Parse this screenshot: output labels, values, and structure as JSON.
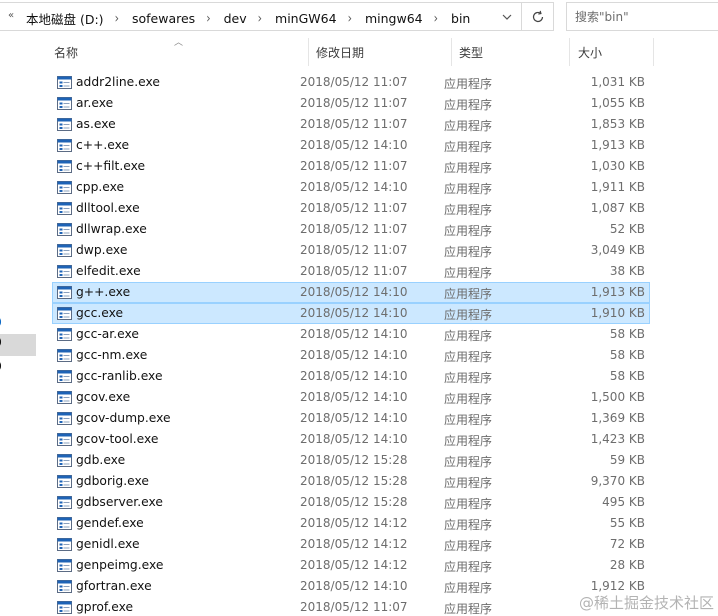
{
  "address_bar": {
    "overflow_glyph": "«",
    "crumbs": [
      "本地磁盘 (D:)",
      "sofewares",
      "dev",
      "minGW64",
      "mingw64",
      "bin"
    ]
  },
  "search": {
    "placeholder": "搜索\"bin\""
  },
  "columns": {
    "name": "名称",
    "date": "修改日期",
    "type": "类型",
    "size": "大小"
  },
  "sort": {
    "column": "name",
    "direction": "ascending"
  },
  "files": [
    {
      "name": "addr2line.exe",
      "modified": "2018/05/12 11:07",
      "type": "应用程序",
      "size": "1,031 KB",
      "selected": false
    },
    {
      "name": "ar.exe",
      "modified": "2018/05/12 11:07",
      "type": "应用程序",
      "size": "1,055 KB",
      "selected": false
    },
    {
      "name": "as.exe",
      "modified": "2018/05/12 11:07",
      "type": "应用程序",
      "size": "1,853 KB",
      "selected": false
    },
    {
      "name": "c++.exe",
      "modified": "2018/05/12 14:10",
      "type": "应用程序",
      "size": "1,913 KB",
      "selected": false
    },
    {
      "name": "c++filt.exe",
      "modified": "2018/05/12 11:07",
      "type": "应用程序",
      "size": "1,030 KB",
      "selected": false
    },
    {
      "name": "cpp.exe",
      "modified": "2018/05/12 14:10",
      "type": "应用程序",
      "size": "1,911 KB",
      "selected": false
    },
    {
      "name": "dlltool.exe",
      "modified": "2018/05/12 11:07",
      "type": "应用程序",
      "size": "1,087 KB",
      "selected": false
    },
    {
      "name": "dllwrap.exe",
      "modified": "2018/05/12 11:07",
      "type": "应用程序",
      "size": "52 KB",
      "selected": false
    },
    {
      "name": "dwp.exe",
      "modified": "2018/05/12 11:07",
      "type": "应用程序",
      "size": "3,049 KB",
      "selected": false
    },
    {
      "name": "elfedit.exe",
      "modified": "2018/05/12 11:07",
      "type": "应用程序",
      "size": "38 KB",
      "selected": false
    },
    {
      "name": "g++.exe",
      "modified": "2018/05/12 14:10",
      "type": "应用程序",
      "size": "1,913 KB",
      "selected": true
    },
    {
      "name": "gcc.exe",
      "modified": "2018/05/12 14:10",
      "type": "应用程序",
      "size": "1,910 KB",
      "selected": true
    },
    {
      "name": "gcc-ar.exe",
      "modified": "2018/05/12 14:10",
      "type": "应用程序",
      "size": "58 KB",
      "selected": false
    },
    {
      "name": "gcc-nm.exe",
      "modified": "2018/05/12 14:10",
      "type": "应用程序",
      "size": "58 KB",
      "selected": false
    },
    {
      "name": "gcc-ranlib.exe",
      "modified": "2018/05/12 14:10",
      "type": "应用程序",
      "size": "58 KB",
      "selected": false
    },
    {
      "name": "gcov.exe",
      "modified": "2018/05/12 14:10",
      "type": "应用程序",
      "size": "1,500 KB",
      "selected": false
    },
    {
      "name": "gcov-dump.exe",
      "modified": "2018/05/12 14:10",
      "type": "应用程序",
      "size": "1,369 KB",
      "selected": false
    },
    {
      "name": "gcov-tool.exe",
      "modified": "2018/05/12 14:10",
      "type": "应用程序",
      "size": "1,423 KB",
      "selected": false
    },
    {
      "name": "gdb.exe",
      "modified": "2018/05/12 15:28",
      "type": "应用程序",
      "size": "59 KB",
      "selected": false
    },
    {
      "name": "gdborig.exe",
      "modified": "2018/05/12 15:28",
      "type": "应用程序",
      "size": "9,370 KB",
      "selected": false
    },
    {
      "name": "gdbserver.exe",
      "modified": "2018/05/12 15:28",
      "type": "应用程序",
      "size": "495 KB",
      "selected": false
    },
    {
      "name": "gendef.exe",
      "modified": "2018/05/12 14:12",
      "type": "应用程序",
      "size": "55 KB",
      "selected": false
    },
    {
      "name": "genidl.exe",
      "modified": "2018/05/12 14:12",
      "type": "应用程序",
      "size": "72 KB",
      "selected": false
    },
    {
      "name": "genpeimg.exe",
      "modified": "2018/05/12 14:12",
      "type": "应用程序",
      "size": "28 KB",
      "selected": false
    },
    {
      "name": "gfortran.exe",
      "modified": "2018/05/12 14:10",
      "type": "应用程序",
      "size": "1,912 KB",
      "selected": false
    },
    {
      "name": "gprof.exe",
      "modified": "2018/05/12 11:07",
      "type": "应用程序",
      "size": "",
      "selected": false
    }
  ],
  "colors": {
    "selection_fill": "#cce8ff",
    "selection_border": "#99d1ff",
    "secondary_text": "#6d6d6d"
  },
  "watermark": "@稀土掘金技术社区"
}
